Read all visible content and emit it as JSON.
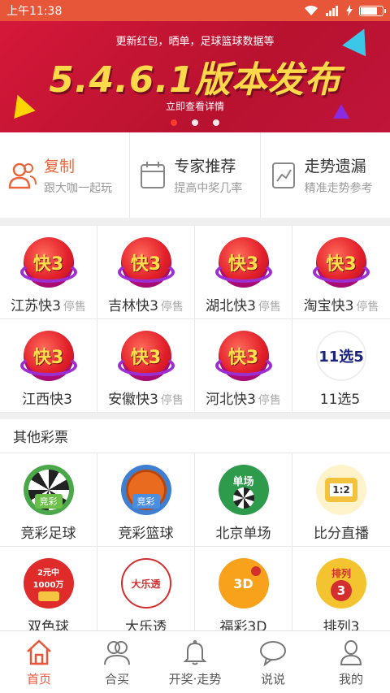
{
  "status_bar": {
    "time": "上午11:38",
    "colors": {
      "background": "#e8563a"
    }
  },
  "banner": {
    "subtitle": "更新红包，晒单，足球篮球数据等",
    "title": "5.4.6.1版本发布",
    "link_text": "立即查看详情",
    "page_count": 3,
    "active_page": 1
  },
  "features": [
    {
      "title": "复制",
      "subtitle": "跟大咖一起玩",
      "icon": "users-icon"
    },
    {
      "title": "专家推荐",
      "subtitle": "提高中奖几率",
      "icon": "calendar-icon"
    },
    {
      "title": "走势遗漏",
      "subtitle": "精准走势参考",
      "icon": "trend-chart-icon"
    }
  ],
  "lotteries": [
    {
      "name": "江苏快3",
      "tag": "停售",
      "logo_text": "快3"
    },
    {
      "name": "吉林快3",
      "tag": "停售",
      "logo_text": "快3"
    },
    {
      "name": "湖北快3",
      "tag": "停售",
      "logo_text": "快3"
    },
    {
      "name": "淘宝快3",
      "tag": "停售",
      "logo_text": "快3"
    },
    {
      "name": "江西快3",
      "tag": "",
      "logo_text": "快3"
    },
    {
      "name": "安徽快3",
      "tag": "停售",
      "logo_text": "快3"
    },
    {
      "name": "河北快3",
      "tag": "停售",
      "logo_text": "快3"
    },
    {
      "name": "11选5",
      "tag": "",
      "logo_text": "11选5"
    }
  ],
  "other_section": {
    "title": "其他彩票",
    "items": [
      {
        "name": "竞彩足球",
        "logo_text": "竞彩"
      },
      {
        "name": "竞彩篮球",
        "logo_text": "竞彩"
      },
      {
        "name": "北京单场",
        "logo_text": "单场"
      },
      {
        "name": "比分直播",
        "logo_text": "1:2"
      },
      {
        "name": "双色球",
        "logo_text": "2元中1000万"
      },
      {
        "name": "大乐透",
        "logo_text": "大乐透"
      },
      {
        "name": "福彩3D",
        "logo_text": "3D"
      },
      {
        "name": "排列3",
        "logo_text": "排列"
      }
    ]
  },
  "bottom_nav": [
    {
      "label": "首页",
      "icon": "home-icon",
      "active": true
    },
    {
      "label": "合买",
      "icon": "group-buy-icon",
      "active": false
    },
    {
      "label": "开奖·走势",
      "icon": "bell-icon",
      "active": false
    },
    {
      "label": "说说",
      "icon": "chat-bubble-icon",
      "active": false
    },
    {
      "label": "我的",
      "icon": "profile-icon",
      "active": false
    }
  ],
  "accent_color": "#e8563a"
}
